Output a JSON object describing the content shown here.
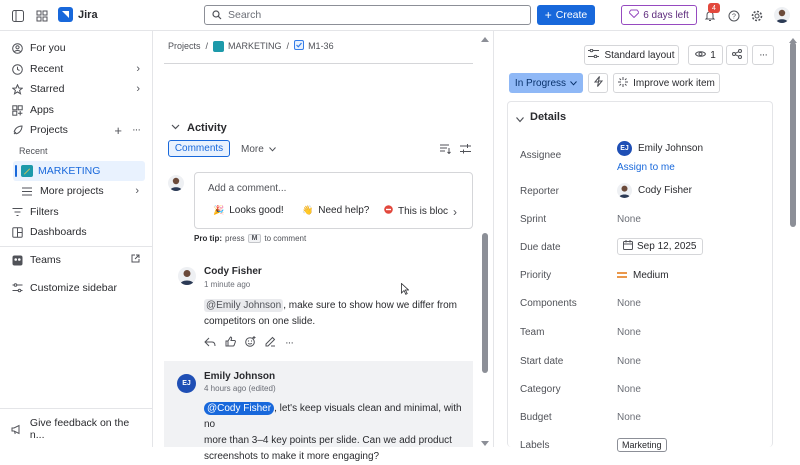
{
  "app": {
    "name": "Jira"
  },
  "search": {
    "placeholder": "Search"
  },
  "topbar": {
    "create_label": "Create",
    "trial_label": "6 days left",
    "notification_count": "4"
  },
  "sidebar": {
    "items": [
      {
        "label": "For you"
      },
      {
        "label": "Recent"
      },
      {
        "label": "Starred"
      },
      {
        "label": "Apps"
      },
      {
        "label": "Projects"
      }
    ],
    "recent_heading": "Recent",
    "project_item": "MARKETING",
    "more_projects": "More projects",
    "filters": "Filters",
    "dashboards": "Dashboards",
    "teams": "Teams",
    "customize": "Customize sidebar",
    "feedback": "Give feedback on the n..."
  },
  "breadcrumb": {
    "projects": "Projects",
    "project": "MARKETING",
    "issue": "M1-36",
    "sep": "/"
  },
  "activity": {
    "title": "Activity",
    "tab_comments": "Comments",
    "tab_more": "More",
    "comment_placeholder": "Add a comment...",
    "quick_replies": [
      {
        "emoji": "🎉",
        "label": "Looks good!"
      },
      {
        "emoji": "👋",
        "label": "Need help?"
      },
      {
        "emoji": "⛔",
        "label": "This is bloc"
      }
    ],
    "protip_prefix": "Pro tip:",
    "protip_press": "press",
    "protip_key": "M",
    "protip_suffix": "to comment"
  },
  "comments": [
    {
      "author": "Cody Fisher",
      "time": "1 minute ago",
      "mention": "@Emily Johnson",
      "text_line1": ", make sure to show how we differ from",
      "text_line2": "competitors on one slide."
    },
    {
      "author": "Emily Johnson",
      "initials": "EJ",
      "time": "4 hours ago (edited)",
      "mention": "@Cody Fisher",
      "text_line1": ", let's keep visuals clean and minimal, with no",
      "text_line2": "more than 3–4 key points per slide. Can we add product",
      "text_line3": "screenshots to make it more engaging?"
    }
  ],
  "right_panel": {
    "layout_label": "Standard layout",
    "watchers": "1",
    "status": "In Progress",
    "improve_label": "Improve work item",
    "details_title": "Details",
    "assignee_label": "Assignee",
    "assignee_name": "Emily Johnson",
    "assignee_initials": "EJ",
    "assign_to_me": "Assign to me",
    "reporter_label": "Reporter",
    "reporter_name": "Cody Fisher",
    "sprint_label": "Sprint",
    "sprint_value": "None",
    "due_label": "Due date",
    "due_value": "Sep 12, 2025",
    "priority_label": "Priority",
    "priority_value": "Medium",
    "components_label": "Components",
    "components_value": "None",
    "team_label": "Team",
    "team_value": "None",
    "start_label": "Start date",
    "start_value": "None",
    "category_label": "Category",
    "category_value": "None",
    "budget_label": "Budget",
    "budget_value": "None",
    "labels_label": "Labels",
    "labels_value": "Marketing"
  },
  "colors": {
    "brand_blue": "#1868db",
    "selected_bg": "#e9f2fe",
    "trial_purple": "#964ac0",
    "badge_red": "#e2483d",
    "priority_orange": "#e06c00"
  }
}
